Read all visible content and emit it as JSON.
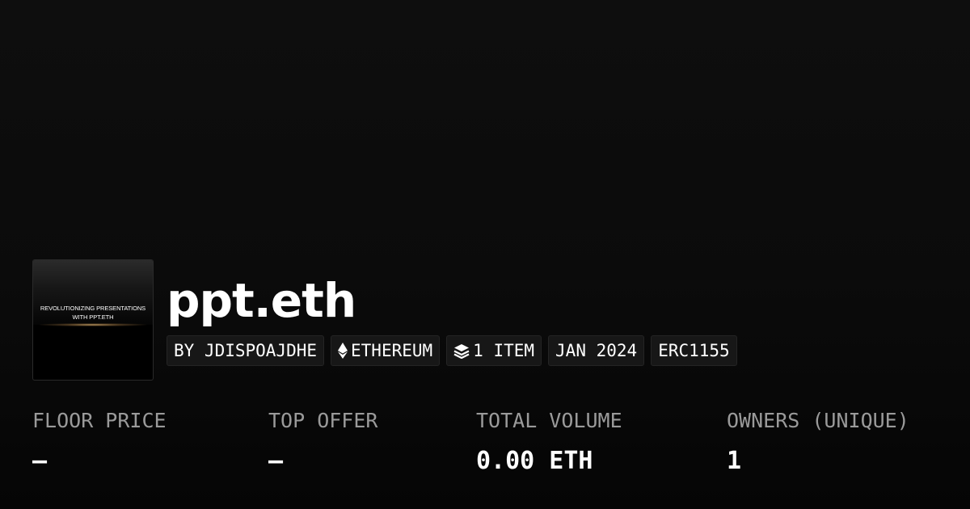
{
  "collection": {
    "title": "ppt.eth",
    "thumbnail": {
      "line1": "REVOLUTIONIZING PRESENTATIONS",
      "line2": "WITH PPT.ETH"
    }
  },
  "tags": [
    {
      "label": "BY JDISPOAJDHE",
      "icon": ""
    },
    {
      "label": "ETHEREUM",
      "icon": "ethereum-icon"
    },
    {
      "label": "1 ITEM",
      "icon": "layers-icon"
    },
    {
      "label": "JAN 2024",
      "icon": ""
    },
    {
      "label": "ERC1155",
      "icon": ""
    }
  ],
  "stats": [
    {
      "label": "FLOOR PRICE",
      "value": "–"
    },
    {
      "label": "TOP OFFER",
      "value": "–"
    },
    {
      "label": "TOTAL VOLUME",
      "value": "0.00 ETH"
    },
    {
      "label": "OWNERS (UNIQUE)",
      "value": "1"
    }
  ],
  "colors": {
    "background": "#0c0c0c",
    "tag_background": "#171717",
    "label": "#9a9a9a",
    "text": "#ffffff"
  }
}
